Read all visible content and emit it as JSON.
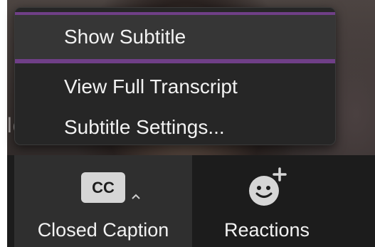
{
  "video": {
    "participant_name_partial": "loch"
  },
  "menu": {
    "items": [
      {
        "label": "Show Subtitle"
      },
      {
        "label": "View Full Transcript"
      },
      {
        "label": "Subtitle Settings..."
      }
    ],
    "highlight_color": "#6f3f87"
  },
  "toolbar": {
    "closed_caption": {
      "icon_text": "CC",
      "label": "Closed Caption",
      "icon": "closed-caption-icon"
    },
    "reactions": {
      "label": "Reactions",
      "icon": "smiley-plus-icon"
    }
  }
}
